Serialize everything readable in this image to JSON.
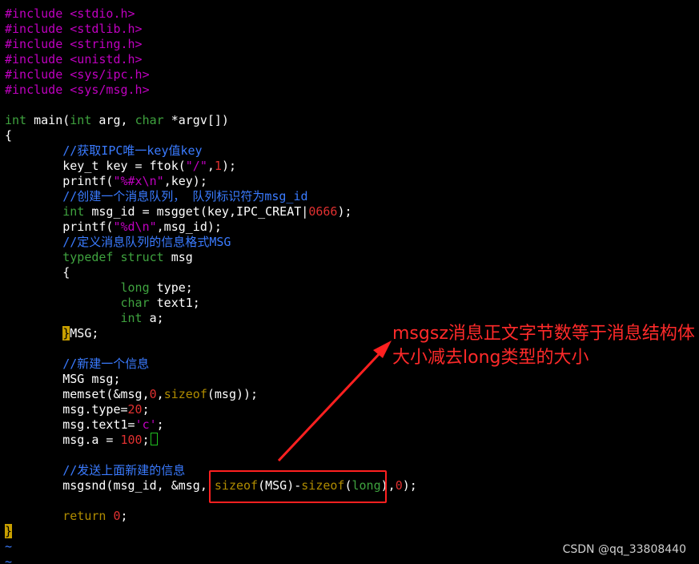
{
  "code_lines": [
    {
      "parts": [
        {
          "t": "#include <stdio.h>",
          "c": "pp"
        }
      ]
    },
    {
      "parts": [
        {
          "t": "#include <stdlib.h>",
          "c": "pp"
        }
      ]
    },
    {
      "parts": [
        {
          "t": "#include <string.h>",
          "c": "pp"
        }
      ]
    },
    {
      "parts": [
        {
          "t": "#include <unistd.h>",
          "c": "pp"
        }
      ]
    },
    {
      "parts": [
        {
          "t": "#include <sys/ipc.h>",
          "c": "pp"
        }
      ]
    },
    {
      "parts": [
        {
          "t": "#include <sys/msg.h>",
          "c": "pp"
        }
      ]
    },
    {
      "parts": []
    },
    {
      "parts": [
        {
          "t": "int",
          "c": "ty"
        },
        {
          "t": " main("
        },
        {
          "t": "int",
          "c": "ty"
        },
        {
          "t": " arg, "
        },
        {
          "t": "char",
          "c": "ty"
        },
        {
          "t": " *argv[])"
        }
      ]
    },
    {
      "parts": [
        {
          "t": "{"
        }
      ]
    },
    {
      "parts": [
        {
          "t": "        "
        },
        {
          "t": "//获取IPC唯一key值key",
          "c": "cm"
        }
      ]
    },
    {
      "parts": [
        {
          "t": "        key_t key = ftok("
        },
        {
          "t": "\"/\"",
          "c": "str"
        },
        {
          "t": ","
        },
        {
          "t": "1",
          "c": "num"
        },
        {
          "t": ");"
        }
      ]
    },
    {
      "parts": [
        {
          "t": "        printf("
        },
        {
          "t": "\"%#x\\n\"",
          "c": "str"
        },
        {
          "t": ",key);"
        }
      ]
    },
    {
      "parts": [
        {
          "t": "        "
        },
        {
          "t": "//创建一个消息队列， 队列标识符为msg_id",
          "c": "cm"
        }
      ]
    },
    {
      "parts": [
        {
          "t": "        "
        },
        {
          "t": "int",
          "c": "ty"
        },
        {
          "t": " msg_id = msgget(key,IPC_CREAT|"
        },
        {
          "t": "0666",
          "c": "num"
        },
        {
          "t": ");"
        }
      ]
    },
    {
      "parts": [
        {
          "t": "        printf("
        },
        {
          "t": "\"%d\\n\"",
          "c": "str"
        },
        {
          "t": ",msg_id);"
        }
      ]
    },
    {
      "parts": [
        {
          "t": "        "
        },
        {
          "t": "//定义消息队列的信息格式MSG",
          "c": "cm"
        }
      ]
    },
    {
      "parts": [
        {
          "t": "        "
        },
        {
          "t": "typedef",
          "c": "ty"
        },
        {
          "t": " "
        },
        {
          "t": "struct",
          "c": "ty"
        },
        {
          "t": " msg"
        }
      ]
    },
    {
      "parts": [
        {
          "t": "        {"
        }
      ]
    },
    {
      "parts": [
        {
          "t": "                "
        },
        {
          "t": "long",
          "c": "ty"
        },
        {
          "t": " type;"
        }
      ]
    },
    {
      "parts": [
        {
          "t": "                "
        },
        {
          "t": "char",
          "c": "ty"
        },
        {
          "t": " text1;"
        }
      ]
    },
    {
      "parts": [
        {
          "t": "                "
        },
        {
          "t": "int",
          "c": "ty"
        },
        {
          "t": " a;"
        }
      ]
    },
    {
      "parts": [
        {
          "t": "        "
        },
        {
          "t": "}",
          "c": "cur-bracket"
        },
        {
          "t": "MSG;"
        }
      ]
    },
    {
      "parts": []
    },
    {
      "parts": [
        {
          "t": "        "
        },
        {
          "t": "//新建一个信息",
          "c": "cm"
        }
      ]
    },
    {
      "parts": [
        {
          "t": "        MSG msg;"
        }
      ]
    },
    {
      "parts": [
        {
          "t": "        memset(&msg,"
        },
        {
          "t": "0",
          "c": "num"
        },
        {
          "t": ","
        },
        {
          "t": "sizeof",
          "c": "kw"
        },
        {
          "t": "(msg));"
        }
      ]
    },
    {
      "parts": [
        {
          "t": "        msg.type="
        },
        {
          "t": "20",
          "c": "num"
        },
        {
          "t": ";"
        }
      ]
    },
    {
      "parts": [
        {
          "t": "        msg.text1="
        },
        {
          "t": "'c'",
          "c": "str"
        },
        {
          "t": ";"
        }
      ]
    },
    {
      "parts": [
        {
          "t": "        msg.a = "
        },
        {
          "t": "100",
          "c": "num"
        },
        {
          "t": ";"
        },
        {
          "t": "",
          "c": "cursor"
        }
      ]
    },
    {
      "parts": []
    },
    {
      "parts": [
        {
          "t": "        "
        },
        {
          "t": "//发送上面新建的信息",
          "c": "cm"
        }
      ]
    },
    {
      "parts": [
        {
          "t": "        msgsnd(msg_id, &msg, "
        },
        {
          "t": "sizeof",
          "c": "kw"
        },
        {
          "t": "(MSG)-"
        },
        {
          "t": "sizeof",
          "c": "kw"
        },
        {
          "t": "("
        },
        {
          "t": "long",
          "c": "ty"
        },
        {
          "t": "),"
        },
        {
          "t": "0",
          "c": "num"
        },
        {
          "t": ");"
        }
      ]
    },
    {
      "parts": []
    },
    {
      "parts": [
        {
          "t": "        "
        },
        {
          "t": "return",
          "c": "kw"
        },
        {
          "t": " "
        },
        {
          "t": "0",
          "c": "num"
        },
        {
          "t": ";"
        }
      ]
    },
    {
      "parts": [
        {
          "t": "}",
          "c": "cur-bracket"
        }
      ]
    },
    {
      "parts": [
        {
          "t": "~",
          "c": "tilde"
        }
      ]
    },
    {
      "parts": [
        {
          "t": "~",
          "c": "tilde"
        }
      ]
    }
  ],
  "annotation": {
    "text": "msgsz消息正文字节数等于消息结构体大小减去long类型的大小"
  },
  "watermark": {
    "text": "CSDN @qq_33808440"
  },
  "colors": {
    "background": "#000000",
    "preprocessor": "#c000c0",
    "type_keyword": "#3fa33f",
    "statement_keyword": "#b08c00",
    "number": "#e03030",
    "comment": "#3a7bff",
    "annotation": "#ff2a2a"
  }
}
